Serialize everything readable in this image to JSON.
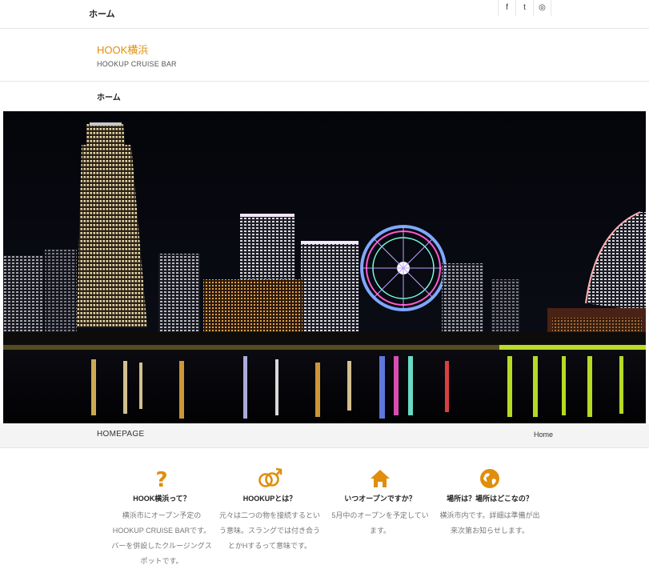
{
  "topbar": {
    "home_label": "ホーム"
  },
  "social": [
    {
      "icon": "facebook-icon",
      "glyph": "f"
    },
    {
      "icon": "twitter-icon",
      "glyph": "t"
    },
    {
      "icon": "instagram-icon",
      "glyph": "◎"
    }
  ],
  "brand": {
    "title": "HOOK横浜",
    "tagline": "HOOKUP CRUISE BAR"
  },
  "nav": {
    "items": [
      {
        "label": "ホーム"
      }
    ]
  },
  "hero": {
    "icon": "city-night-skyline-image"
  },
  "pagebar": {
    "heading": "HOMEPAGE",
    "breadcrumb": "Home"
  },
  "features": [
    {
      "icon": "question-icon",
      "title": "HOOK横浜って？",
      "text": "横浜市にオープン予定のHOOKUP CRUISE BARです。バーを併設したクルージングスポットです。"
    },
    {
      "icon": "gender-icon",
      "title": "HOOKUPとは？",
      "text": "元々は二つの物を接続するという意味。スラングでは付き合うとかHするって意味です。"
    },
    {
      "icon": "home-icon",
      "title": "いつオープンですか？",
      "text": "5月中のオープンを予定しています。"
    },
    {
      "icon": "globe-icon",
      "title": "場所は？場所はどこなの？",
      "text": "横浜市内です。詳細は準備が出来次第お知らせします。"
    }
  ],
  "colors": {
    "accent": "#e08e0b"
  }
}
